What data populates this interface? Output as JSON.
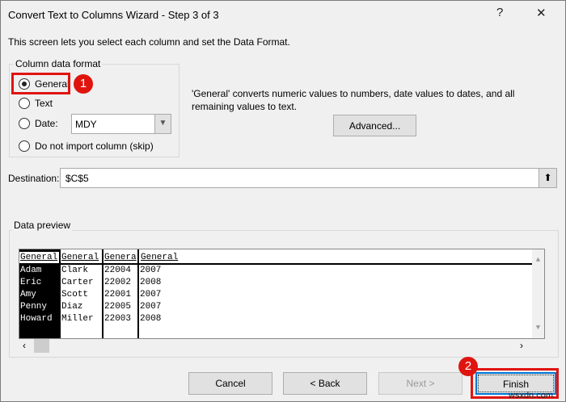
{
  "title": "Convert Text to Columns Wizard - Step 3 of 3",
  "help_label": "?",
  "close_label": "✕",
  "description": "This screen lets you select each column and set the Data Format.",
  "format_group": {
    "label": "Column data format",
    "options": [
      {
        "label": "General",
        "selected": true
      },
      {
        "label": "Text",
        "selected": false
      },
      {
        "label": "Date:",
        "selected": false
      },
      {
        "label": "Do not import column (skip)",
        "selected": false
      }
    ],
    "date_value": "MDY"
  },
  "info_line1": "'General' converts numeric values to numbers, date values to dates, and all",
  "info_line2": "remaining values to text.",
  "advanced_label": "Advanced...",
  "destination": {
    "label": "Destination:",
    "value": "$C$5",
    "button_icon": "collapse-dialog-icon"
  },
  "preview": {
    "label": "Data preview",
    "headers": [
      "General",
      "General",
      "Genera",
      "General"
    ],
    "rows": [
      [
        "Adam",
        "Clark",
        "22004",
        "2007"
      ],
      [
        "Eric",
        "Carter",
        "22002",
        "2008"
      ],
      [
        "Amy",
        "Scott",
        "22001",
        "2007"
      ],
      [
        "Penny",
        "Diaz",
        "22005",
        "2007"
      ],
      [
        "Howard",
        "Miller",
        "22003",
        "2008"
      ]
    ]
  },
  "buttons": {
    "cancel": "Cancel",
    "back": "< Back",
    "next": "Next >",
    "finish": "Finish"
  },
  "badges": [
    "1",
    "2"
  ],
  "watermark": "wsxdn.com",
  "accent": "#e0140f"
}
